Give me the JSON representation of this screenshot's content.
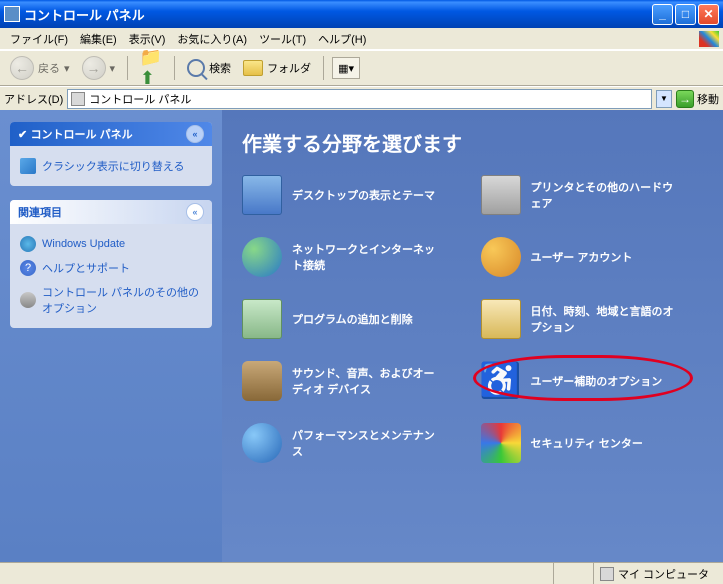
{
  "window": {
    "title": "コントロール パネル"
  },
  "menus": {
    "file": "ファイル(F)",
    "edit": "編集(E)",
    "view": "表示(V)",
    "favorites": "お気に入り(A)",
    "tools": "ツール(T)",
    "help": "ヘルプ(H)"
  },
  "toolbar": {
    "back": "戻る",
    "search": "検索",
    "folders": "フォルダ"
  },
  "address": {
    "label": "アドレス(D)",
    "value": "コントロール パネル",
    "go": "移動"
  },
  "sidebar": {
    "main_panel": {
      "title": "コントロール パネル",
      "switch": "クラシック表示に切り替える"
    },
    "related": {
      "title": "関連項目",
      "items": [
        "Windows Update",
        "ヘルプとサポート",
        "コントロール パネルのその他のオプション"
      ]
    }
  },
  "main": {
    "heading": "作業する分野を選びます",
    "categories": [
      {
        "label": "デスクトップの表示とテーマ"
      },
      {
        "label": "プリンタとその他のハードウェア"
      },
      {
        "label": "ネットワークとインターネット接続"
      },
      {
        "label": "ユーザー アカウント"
      },
      {
        "label": "プログラムの追加と削除"
      },
      {
        "label": "日付、時刻、地域と言語のオプション"
      },
      {
        "label": "サウンド、音声、およびオーディオ デバイス"
      },
      {
        "label": "ユーザー補助のオプション"
      },
      {
        "label": "パフォーマンスとメンテナンス"
      },
      {
        "label": "セキュリティ センター"
      }
    ]
  },
  "statusbar": {
    "location": "マイ コンピュータ"
  }
}
